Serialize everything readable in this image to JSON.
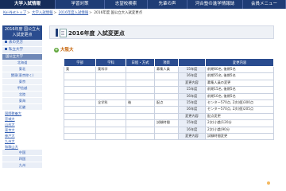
{
  "nav": {
    "tabs": [
      "大学入試情報",
      "学習対策",
      "志望校検索",
      "先輩の声",
      "河合塾の進学情報誌",
      "会員メニュー"
    ]
  },
  "breadcrumb": {
    "items": [
      "Kei-Netトップ",
      "大学入試情報",
      "2016年度入試情報"
    ],
    "current": "2016年度 国公立大入試変更点"
  },
  "sidebar": {
    "title_line1": "2016年度 国公立大",
    "title_line2": "入試変更点",
    "top_items": [
      "表の見方",
      "私立大学"
    ],
    "group": "国公立大学",
    "sub_items": [
      "北海道",
      "東北",
      "関東(東京除く)",
      "東京",
      "甲信越",
      "北陸",
      "東海",
      "近畿"
    ],
    "links": [
      "国際教養大",
      "宮城大",
      "山形大",
      "東京大",
      "神戸大",
      "九州大",
      "和歌山大"
    ],
    "regions": [
      "中国",
      "四国",
      "九州"
    ]
  },
  "page": {
    "title": "2016年度 入試変更点"
  },
  "university": {
    "name": "大阪大",
    "icon": "plus-icon"
  },
  "table": {
    "headers": [
      "学部",
      "学科",
      "日程・方式",
      "項目",
      "",
      "変更内容"
    ],
    "rows": [
      [
        "薬",
        "薬科学",
        "",
        "募集人員",
        "15年度",
        "前期60名, 後期5名"
      ],
      [
        "",
        "",
        "",
        "",
        "16年度",
        "前期55名, 後期5名"
      ],
      [
        "",
        "",
        "",
        "",
        "変更内容",
        "募集人員の変更"
      ],
      [
        "",
        "",
        "",
        "",
        "15年度",
        "前期15名, 後期5名"
      ],
      [
        "",
        "",
        "",
        "",
        "16年度",
        "前期10名, 後期5名"
      ],
      [
        "",
        "全学科",
        "後",
        "配点",
        "15年度",
        "センター570点, 2次(個)300点"
      ],
      [
        "",
        "",
        "",
        "",
        "16年度",
        "センター570点, 2次(個)205点"
      ],
      [
        "",
        "",
        "",
        "",
        "変更内容",
        "配点変更"
      ],
      [
        "",
        "",
        "",
        "試験時間",
        "15年度",
        "2次(小論)120分"
      ],
      [
        "",
        "",
        "",
        "",
        "16年度",
        "2次(小論)90分"
      ],
      [
        "",
        "",
        "",
        "",
        "変更内容",
        "試験時間変更"
      ]
    ]
  },
  "colors": {
    "nav": "#1f3d76",
    "accent": "#2a4c8f",
    "university": "#c45f00"
  }
}
